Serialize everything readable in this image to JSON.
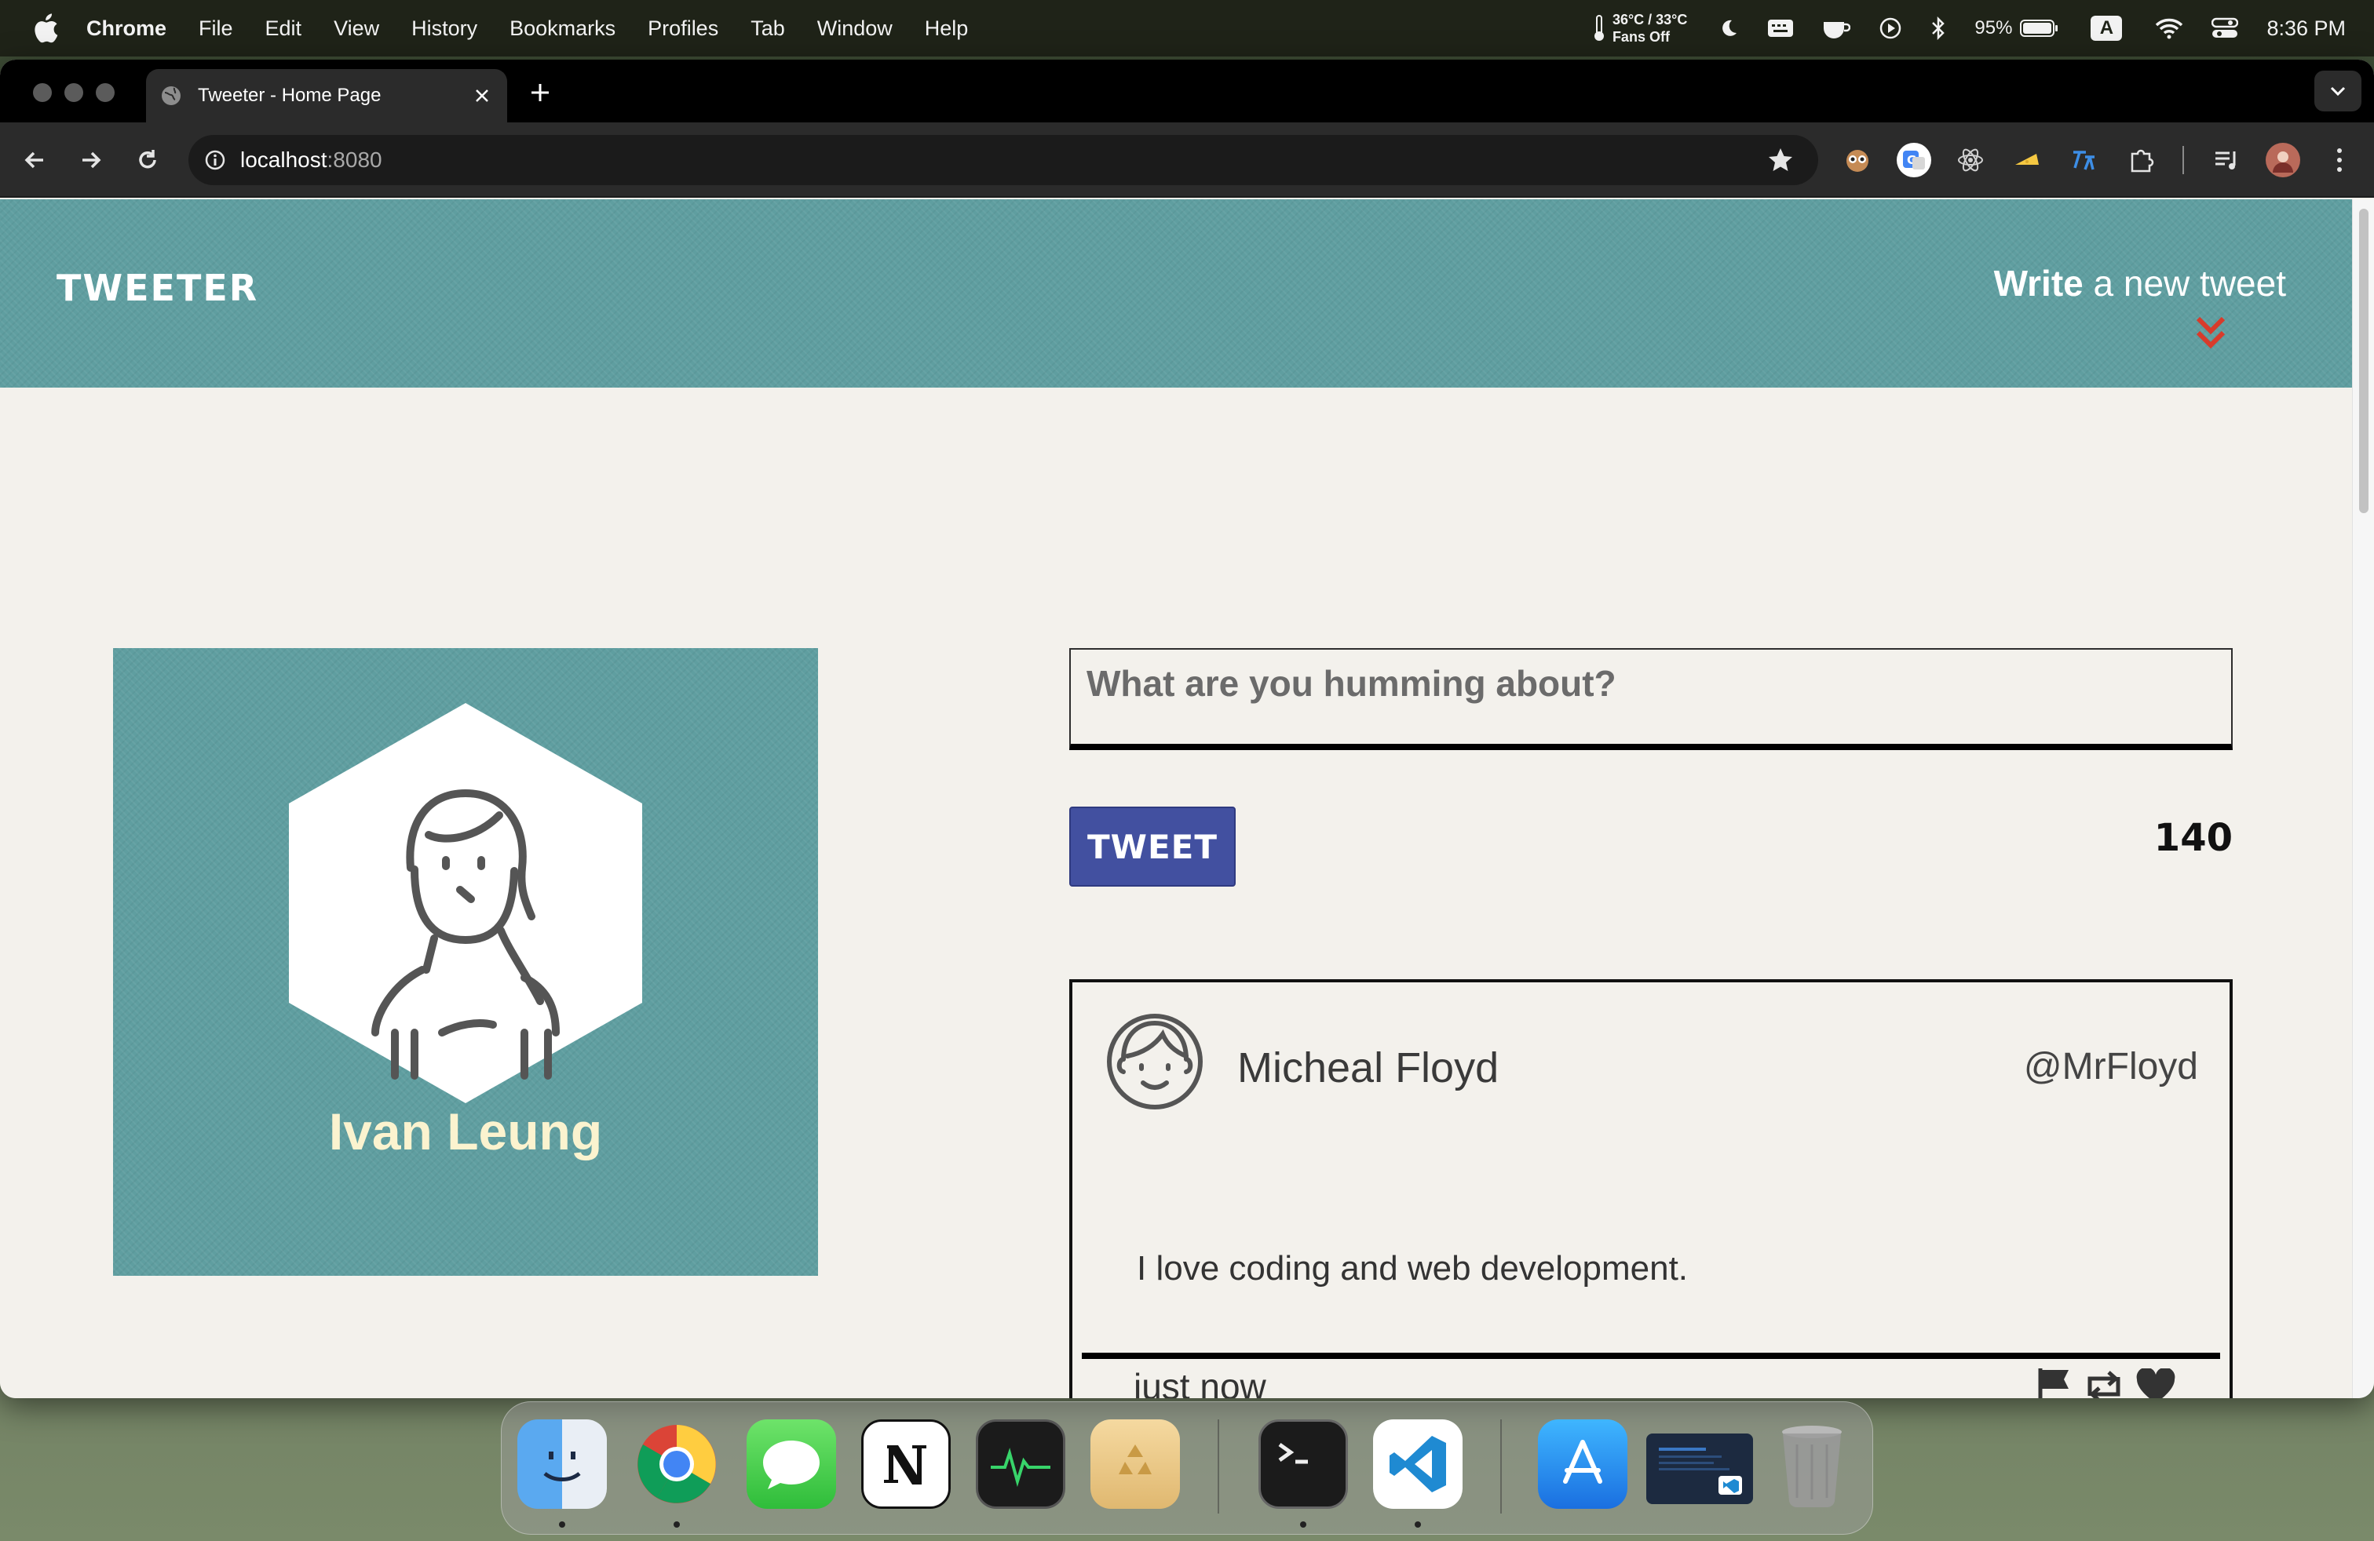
{
  "menubar": {
    "app_name": "Chrome",
    "items": [
      "File",
      "Edit",
      "View",
      "History",
      "Bookmarks",
      "Profiles",
      "Tab",
      "Window",
      "Help"
    ],
    "temp_line1": "36°C / 33°C",
    "temp_line2": "Fans Off",
    "battery": "95%",
    "input_source": "A",
    "clock": "8:36 PM"
  },
  "browser": {
    "tab_title": "Tweeter - Home Page",
    "url_host": "localhost",
    "url_port": ":8080"
  },
  "site": {
    "brand": "TWEETER",
    "compose_toggle_bold": "Write",
    "compose_toggle_rest": " a new tweet",
    "accent_color": "#5f9ea0",
    "chevron_color": "#d83b2b"
  },
  "profile": {
    "name": "Ivan Leung"
  },
  "compose": {
    "placeholder": "What are you humming about?",
    "button_label": "TWEET",
    "counter": "140"
  },
  "tweet": {
    "author_name": "Micheal Floyd",
    "author_handle": "@MrFloyd",
    "content": "I love coding and web development.",
    "timestamp": "just now",
    "actions": [
      "flag-icon",
      "retweet-icon",
      "heart-icon"
    ]
  },
  "dock": {
    "apps": [
      "Finder",
      "Google Chrome",
      "Messages",
      "Notion",
      "Activity Monitor",
      "Recycle",
      "Terminal",
      "Visual Studio Code",
      "App Store",
      "VS Code Window",
      "Trash"
    ]
  }
}
